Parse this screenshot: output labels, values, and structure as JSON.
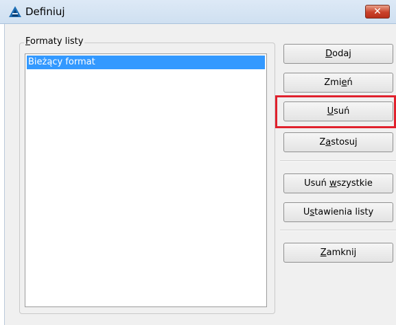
{
  "window": {
    "title": "Definiuj",
    "close_glyph": "✕",
    "app_icon": "triangle-app-icon"
  },
  "group": {
    "label_underlined": "F",
    "label_rest": "ormaty listy"
  },
  "list": {
    "items": [
      "Bieżący format"
    ],
    "selected_index": 0
  },
  "buttons": {
    "add": {
      "pre": "",
      "u": "D",
      "post": "odaj"
    },
    "change": {
      "pre": "Zmi",
      "u": "e",
      "post": "ń"
    },
    "delete": {
      "pre": "",
      "u": "U",
      "post": "suń"
    },
    "apply": {
      "pre": "Z",
      "u": "a",
      "post": "stosuj"
    },
    "delete_all": {
      "pre": "Usuń ",
      "u": "w",
      "post": "szystkie"
    },
    "list_settings": {
      "pre": "U",
      "u": "s",
      "post": "tawienia listy"
    },
    "close": {
      "pre": "",
      "u": "Z",
      "post": "amknij"
    }
  },
  "colors": {
    "selection": "#3399ff",
    "highlight_frame": "#e0202c",
    "close_button": "#c9412a"
  }
}
